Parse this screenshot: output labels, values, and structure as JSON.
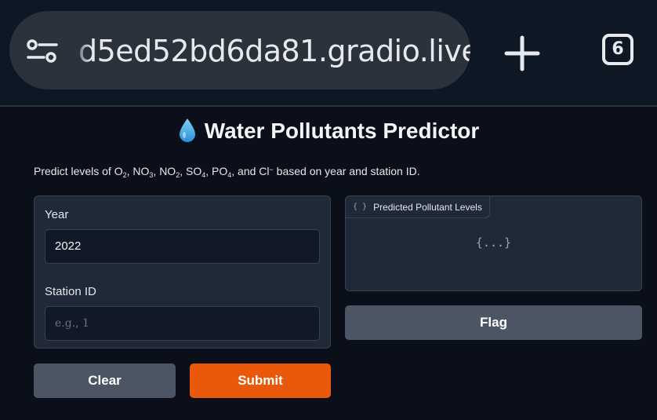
{
  "browser": {
    "url": "d5ed52bd6da81.gradio.live",
    "tab_count": "6"
  },
  "app": {
    "title": "Water Pollutants Predictor",
    "title_icon": "water-drop-icon",
    "description": {
      "prefix": "Predict levels of O",
      "o2_sub": "2",
      "sep1": ", NO",
      "no3_sub": "3",
      "sep2": ", NO",
      "no2_sub": "2",
      "sep3": ", SO",
      "so4_sub": "4",
      "sep4": ", PO",
      "po4_sub": "4",
      "sep5": ", and Cl",
      "cl_sup": "−",
      "suffix": " based on year and station ID."
    },
    "inputs": {
      "year_label": "Year",
      "year_value": "2022",
      "station_label": "Station ID",
      "station_value": "",
      "station_placeholder": "e.g., 1"
    },
    "buttons": {
      "clear": "Clear",
      "submit": "Submit",
      "flag": "Flag"
    },
    "output": {
      "label": "Predicted Pollutant Levels",
      "tag_icon": "{ }",
      "placeholder": "{...}"
    },
    "colors": {
      "accent": "#ea580c",
      "secondary_button": "#4b5563",
      "panel": "#1f2937",
      "background": "#0b0f19"
    }
  }
}
